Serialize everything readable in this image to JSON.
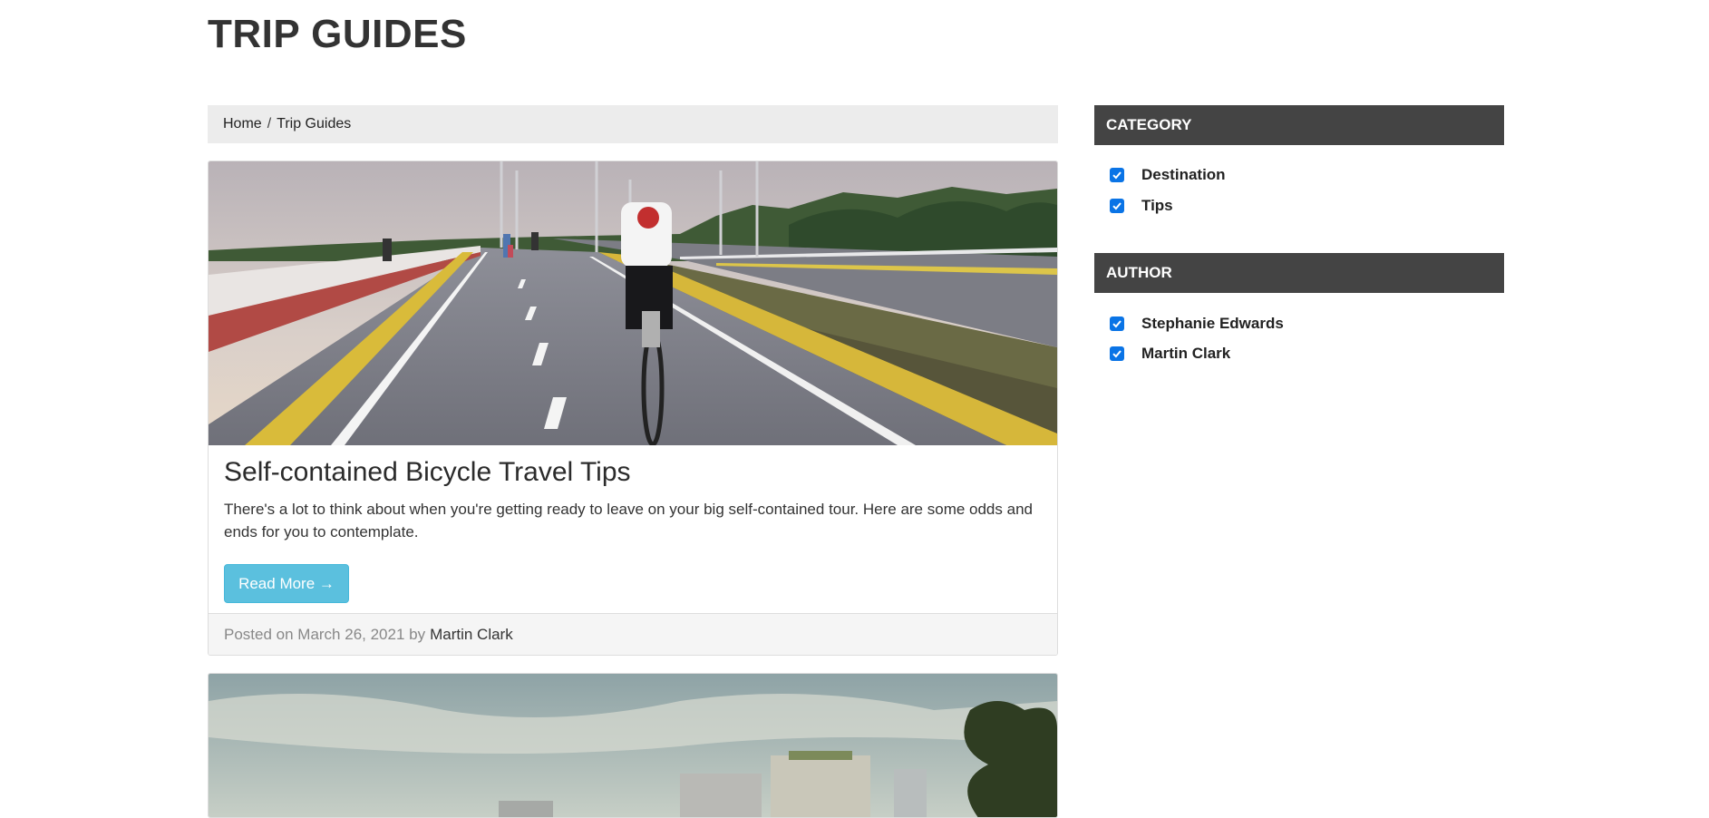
{
  "page": {
    "title": "TRIP GUIDES"
  },
  "breadcrumb": {
    "home": "Home",
    "separator": "/",
    "current": "Trip Guides"
  },
  "posts": [
    {
      "title": "Self-contained Bicycle Travel Tips",
      "excerpt": "There's a lot to think about when you're getting ready to leave on your big self-contained tour. Here are some odds and ends for you to contemplate.",
      "read_more_label": "Read More →",
      "posted_on_prefix": "Posted on March 26, 2021 by",
      "author": "Martin Clark"
    }
  ],
  "sidebar": {
    "category": {
      "heading": "CATEGORY",
      "items": [
        {
          "label": "Destination",
          "checked": true
        },
        {
          "label": "Tips",
          "checked": true
        }
      ]
    },
    "author": {
      "heading": "AUTHOR",
      "items": [
        {
          "label": "Stephanie Edwards",
          "checked": true
        },
        {
          "label": "Martin Clark",
          "checked": true
        }
      ]
    }
  },
  "colors": {
    "widget_header_bg": "#444444",
    "button_info": "#5bc0de",
    "checkbox_checked": "#0a74e6",
    "breadcrumb_bg": "#ececec"
  }
}
